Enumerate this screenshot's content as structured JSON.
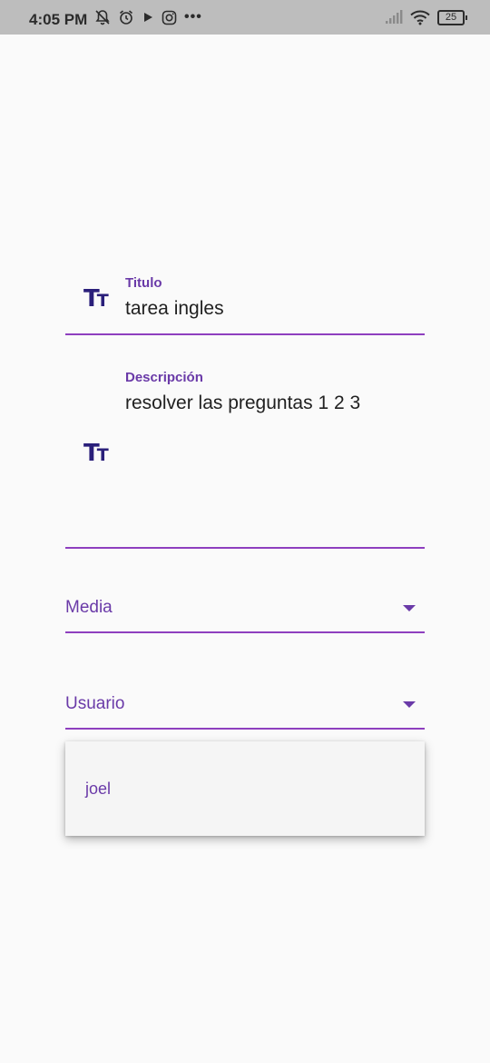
{
  "status_bar": {
    "time": "4:05 PM",
    "left_icons": [
      "bell-off-icon",
      "alarm-icon",
      "play-icon",
      "instagram-icon"
    ],
    "more": "•••",
    "battery": "25"
  },
  "form": {
    "title_field": {
      "label": "Titulo",
      "value": "tarea ingles",
      "icon": "text-fields-icon"
    },
    "description_field": {
      "label": "Descripción",
      "value": "resolver las preguntas 1 2 3",
      "icon": "text-fields-icon"
    },
    "priority_dropdown": {
      "selected": "Media"
    },
    "user_dropdown": {
      "selected": "Usuario"
    }
  },
  "user_menu": {
    "options": [
      "joel"
    ]
  },
  "colors": {
    "accent": "#6a3aa8",
    "underline": "#8e3fbf",
    "icon": "#2a1f7a",
    "background": "#fafafa",
    "status_bar": "#bdbdbd"
  }
}
